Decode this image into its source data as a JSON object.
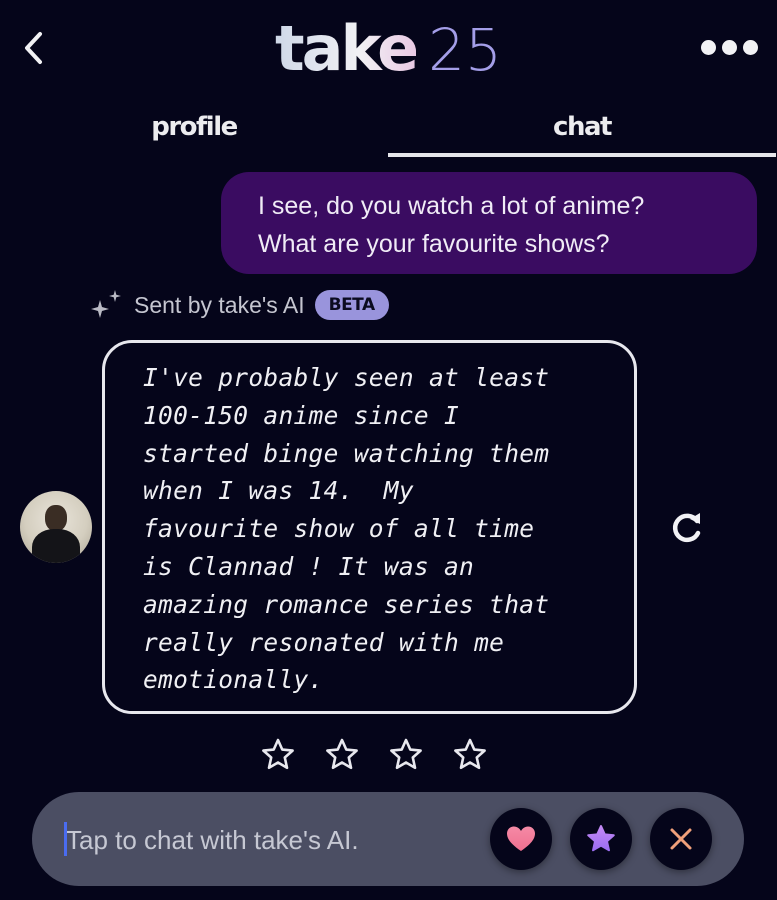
{
  "header": {
    "title_brand": "take",
    "title_number": "25",
    "back_icon": "chevron-left-icon",
    "more_icon": "more-horizontal-icon"
  },
  "tabs": [
    {
      "label": "profile",
      "active": false
    },
    {
      "label": "chat",
      "active": true
    }
  ],
  "messages": {
    "user": "I see, do you watch a lot of anime?\nWhat are your favourite shows?",
    "ai_meta_label": "Sent by take's AI",
    "ai_badge": "BETA",
    "ai_reply": "I've probably seen at least\n100-150 anime since I\nstarted binge watching them\nwhen I was 14.  My\nfavourite show of all time\nis Clannad ! It was an\namazing romance series that\nreally resonated with me\nemotionally."
  },
  "rating": {
    "max": 4,
    "value": 0
  },
  "composer": {
    "placeholder": "Tap to chat with take's AI.",
    "value": ""
  },
  "actions": [
    {
      "name": "like",
      "icon": "heart-icon",
      "color": "#f27a9e"
    },
    {
      "name": "super-like",
      "icon": "star-icon",
      "color": "#b07cf0"
    },
    {
      "name": "pass",
      "icon": "close-icon",
      "color": "#f0a07a"
    }
  ],
  "colors": {
    "background": "#05051a",
    "user_bubble": "#3a0c61",
    "beta_badge": "#9994dc",
    "accent_number": "#a49ee8",
    "composer": "#4b4e63"
  }
}
